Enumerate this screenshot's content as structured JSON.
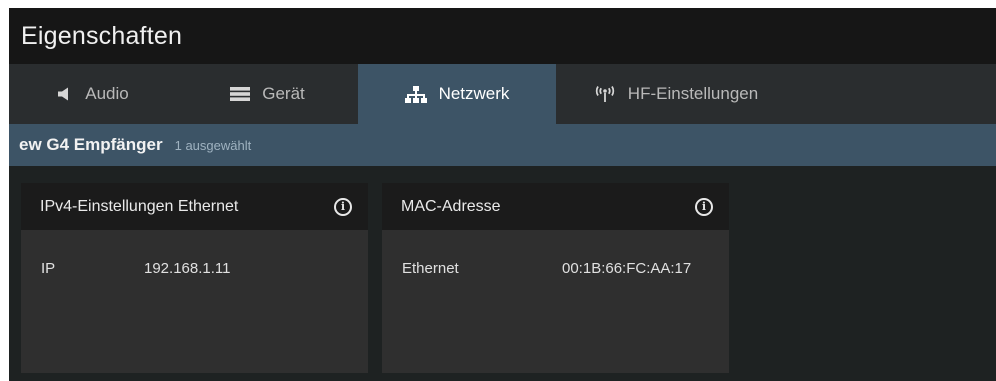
{
  "window": {
    "title": "Eigenschaften"
  },
  "tabs": [
    {
      "label": "Audio",
      "icon": "speaker-icon",
      "active": false
    },
    {
      "label": "Gerät",
      "icon": "server-icon",
      "active": false
    },
    {
      "label": "Netzwerk",
      "icon": "network-icon",
      "active": true
    },
    {
      "label": "HF-Einstellungen",
      "icon": "antenna-icon",
      "active": false
    }
  ],
  "device": {
    "name": "ew G4 Empfänger",
    "selection": "1 ausgewählt"
  },
  "ipv4_card": {
    "title": "IPv4-Einstellungen Ethernet",
    "info_icon": "info-icon",
    "row": {
      "label": "IP",
      "value": "192.168.1.11"
    }
  },
  "mac_card": {
    "title": "MAC-Adresse",
    "info_icon": "info-icon",
    "row": {
      "label": "Ethernet",
      "value": "00:1B:66:FC:AA:17"
    }
  },
  "colors": {
    "accent": "#3d5466",
    "titlebar": "#161616",
    "tabbar": "#2a2d2f",
    "card_body": "#2f2f2f",
    "card_header": "#1b1b1b",
    "background": "#1e2222"
  }
}
